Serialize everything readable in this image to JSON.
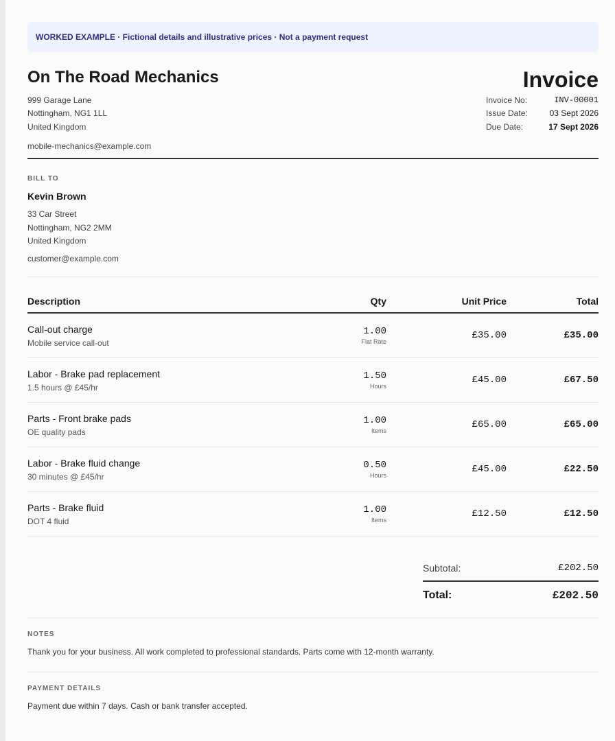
{
  "banner": "WORKED EXAMPLE · Fictional details and illustrative prices · Not a payment request",
  "company": {
    "name": "On The Road Mechanics",
    "address": [
      "999 Garage Lane",
      "Nottingham, NG1 1LL",
      "United Kingdom"
    ],
    "email": "mobile-mechanics@example.com"
  },
  "invoice": {
    "title": "Invoice",
    "meta": [
      {
        "label": "Invoice No:",
        "value": "INV-00001"
      },
      {
        "label": "Issue Date:",
        "value": "03 Sept 2026"
      },
      {
        "label": "Due Date:",
        "value": "17 Sept 2026"
      }
    ]
  },
  "bill_to": {
    "label": "BILL TO",
    "name": "Kevin Brown",
    "address": [
      "33 Car Street",
      "Nottingham, NG2 2MM",
      "United Kingdom"
    ],
    "email": "customer@example.com"
  },
  "table": {
    "headers": {
      "description": "Description",
      "qty": "Qty",
      "unit_price": "Unit Price",
      "total": "Total"
    },
    "rows": [
      {
        "title": "Call-out charge",
        "sub": "Mobile service call-out",
        "qty": "1.00",
        "unit": "Flat Rate",
        "price": "£35.00",
        "total": "£35.00"
      },
      {
        "title": "Labor - Brake pad replacement",
        "sub": "1.5 hours @ £45/hr",
        "qty": "1.50",
        "unit": "Hours",
        "price": "£45.00",
        "total": "£67.50"
      },
      {
        "title": "Parts - Front brake pads",
        "sub": "OE quality pads",
        "qty": "1.00",
        "unit": "Items",
        "price": "£65.00",
        "total": "£65.00"
      },
      {
        "title": "Labor - Brake fluid change",
        "sub": "30 minutes @ £45/hr",
        "qty": "0.50",
        "unit": "Hours",
        "price": "£45.00",
        "total": "£22.50"
      },
      {
        "title": "Parts - Brake fluid",
        "sub": "DOT 4 fluid",
        "qty": "1.00",
        "unit": "Items",
        "price": "£12.50",
        "total": "£12.50"
      }
    ]
  },
  "totals": {
    "subtotal_label": "Subtotal:",
    "subtotal_value": "£202.50",
    "total_label": "Total:",
    "total_value": "£202.50"
  },
  "notes": {
    "label": "NOTES",
    "text": "Thank you for your business. All work completed to professional standards. Parts come with 12-month warranty."
  },
  "payment": {
    "label": "PAYMENT DETAILS",
    "text": "Payment due within 7 days. Cash or bank transfer accepted."
  }
}
